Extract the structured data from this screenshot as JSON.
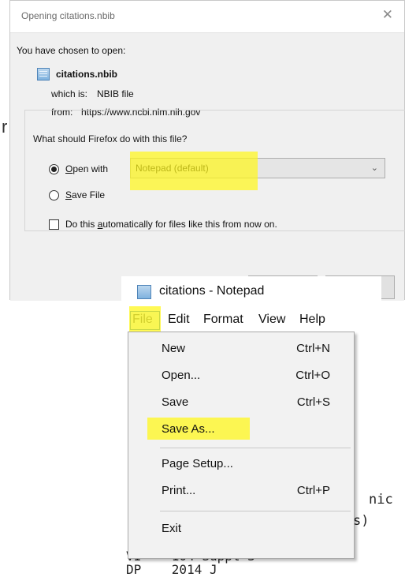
{
  "dialog": {
    "title": "Opening citations.nbib",
    "close_glyph": "✕",
    "chosen_label": "You have chosen to open:",
    "file_name": "citations.nbib",
    "which_is_label": "which is:",
    "which_is_value": "NBIB file",
    "from_label": "from:",
    "from_value": "https://www.ncbi.nlm.nih.gov",
    "group_legend": "What should Firefox do with this file?",
    "open_with": {
      "mnemonic": "O",
      "rest": "pen with",
      "checked": true
    },
    "app_select_value": "Notepad (default)",
    "save_file": {
      "mnemonic": "S",
      "rest": "ave File",
      "checked": false
    },
    "auto": {
      "before": "Do this ",
      "mnemonic": "a",
      "after": "utomatically for files like this from now on.",
      "checked": false
    }
  },
  "notepad": {
    "title": "citations - Notepad",
    "menus": [
      "File",
      "Edit",
      "Format",
      "View",
      "Help"
    ],
    "file_menu": [
      {
        "label": "New",
        "shortcut": "Ctrl+N"
      },
      {
        "label": "Open...",
        "shortcut": "Ctrl+O"
      },
      {
        "label": "Save",
        "shortcut": "Ctrl+S"
      },
      {
        "label": "Save As...",
        "shortcut": ""
      },
      {
        "label": "Page Setup...",
        "shortcut": ""
      },
      {
        "label": "Print...",
        "shortcut": "Ctrl+P"
      },
      {
        "label": "Exit",
        "shortcut": ""
      }
    ]
  },
  "background": {
    "left_edge_char": "r",
    "frag_1": "nic",
    "frag_2": "s)",
    "frag_3": "VI    104 Suppl 3",
    "frag_4": "DP    2014 J"
  },
  "colors": {
    "highlight": "#FFF71C",
    "dialog_body": "#F0F0F0",
    "menu_bg": "#F2F2F2",
    "file_focus_border": "#2A7CC7"
  },
  "icons": {
    "file": "nbib-file-icon",
    "notepad": "notepad-app-icon",
    "close": "close-icon",
    "dropdown": "chevron-down-icon"
  }
}
